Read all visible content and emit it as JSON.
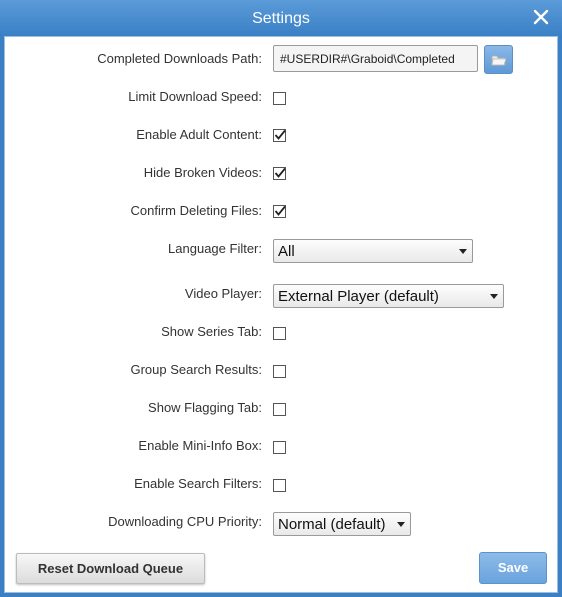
{
  "window": {
    "title": "Settings",
    "close_icon": "close-icon"
  },
  "settings": {
    "completed_path": {
      "label": "Completed Downloads Path:",
      "value": "#USERDIR#\\Graboid\\Completed",
      "browse_icon": "folder-icon"
    },
    "limit_download_speed": {
      "label": "Limit Download Speed:",
      "checked": false
    },
    "enable_adult_content": {
      "label": "Enable Adult Content:",
      "checked": true
    },
    "hide_broken_videos": {
      "label": "Hide Broken Videos:",
      "checked": true
    },
    "confirm_deleting_files": {
      "label": "Confirm Deleting Files:",
      "checked": true
    },
    "language_filter": {
      "label": "Language Filter:",
      "value": "All"
    },
    "video_player": {
      "label": "Video Player:",
      "value": "External Player (default)"
    },
    "show_series_tab": {
      "label": "Show Series Tab:",
      "checked": false
    },
    "group_search_results": {
      "label": "Group Search Results:",
      "checked": false
    },
    "show_flagging_tab": {
      "label": "Show Flagging Tab:",
      "checked": false
    },
    "enable_mini_info_box": {
      "label": "Enable Mini-Info Box:",
      "checked": false
    },
    "enable_search_filters": {
      "label": "Enable Search Filters:",
      "checked": false
    },
    "cpu_priority": {
      "label": "Downloading CPU Priority:",
      "value": "Normal (default)"
    }
  },
  "buttons": {
    "reset_label": "Reset Download Queue",
    "save_label": "Save"
  },
  "colors": {
    "title_bar": "#3b7fc4",
    "save_button": "#6aa3dd"
  }
}
